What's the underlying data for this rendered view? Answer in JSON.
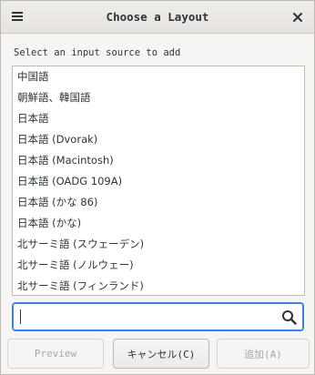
{
  "window": {
    "title": "Choose a Layout"
  },
  "prompt": "Select an input source to add",
  "layouts": [
    "中国語",
    "朝鮮語、韓国語",
    "日本語",
    "日本語 (Dvorak)",
    "日本語 (Macintosh)",
    "日本語 (OADG 109A)",
    "日本語 (かな 86)",
    "日本語 (かな)",
    "北サーミ語 (スウェーデン)",
    "北サーミ語 (ノルウェー)",
    "北サーミ語 (フィンランド)"
  ],
  "search": {
    "value": "",
    "placeholder": ""
  },
  "buttons": {
    "preview": "Preview",
    "cancel": "キャンセル(C)",
    "add": "追加(A)"
  },
  "colors": {
    "focus_accent": "#3584e4",
    "dialog_bg": "#f6f5f4",
    "list_bg": "#ffffff"
  },
  "icons": {
    "menu": "hamburger-menu-icon",
    "close": "close-icon",
    "search": "search-icon"
  }
}
